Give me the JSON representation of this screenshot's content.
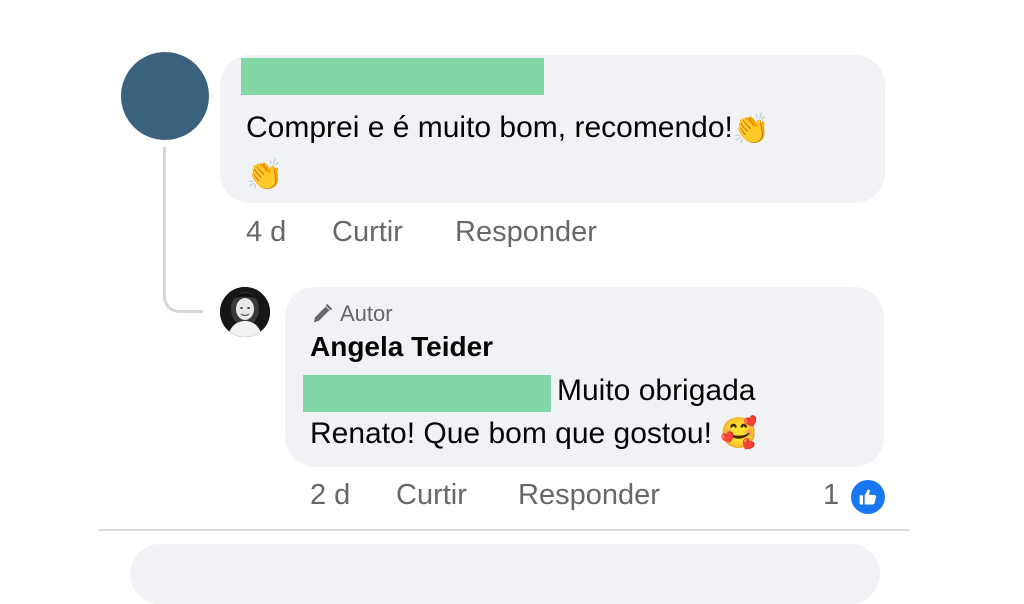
{
  "comment": {
    "text": "Comprei e é muito bom, recomendo!",
    "emoji_a": "👏",
    "emoji_b": "👏",
    "time": "4 d",
    "like_label": "Curtir",
    "reply_label": "Responder"
  },
  "reply": {
    "badge": "Autor",
    "author": "Angela Teider",
    "text_line1": "Muito obrigada",
    "text_line2": "Renato! Que bom que gostou!",
    "emoji": "🥰",
    "time": "2 d",
    "like_label": "Curtir",
    "reply_label": "Responder",
    "reaction_count": "1"
  },
  "icons": {
    "badge_icon": "pencil-icon",
    "reaction_icon": "thumbs-up-icon"
  },
  "colors": {
    "avatar": "#3a627f",
    "bubble": "#f0f2f5",
    "redaction": "#81d8a6",
    "like_blue": "#1877f2",
    "muted_text": "#65676b"
  }
}
